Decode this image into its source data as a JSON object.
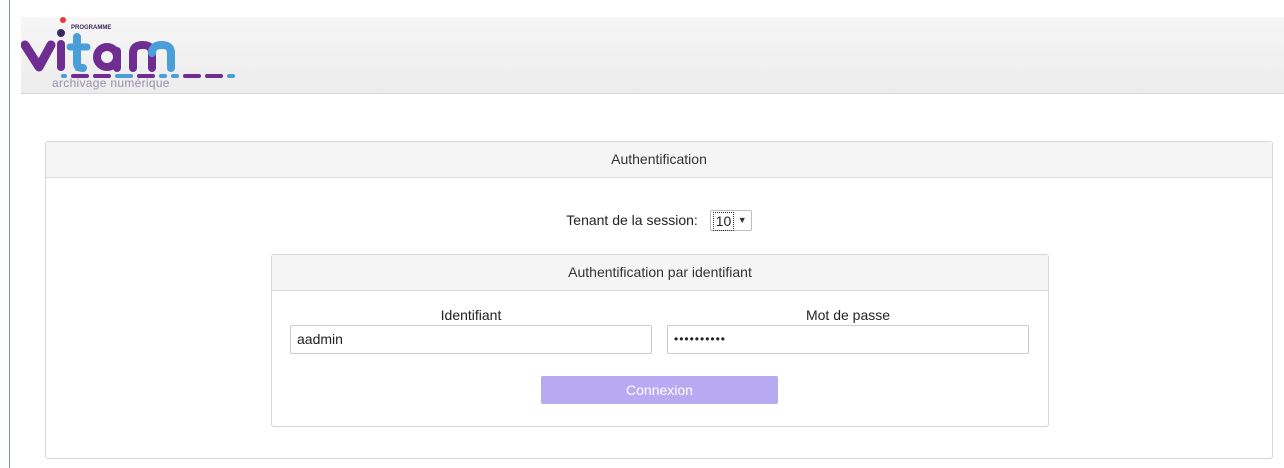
{
  "logo": {
    "programme": "PROGRAMME",
    "name": "vitam",
    "subtitle": "archivage numérique"
  },
  "auth_panel": {
    "title": "Authentification",
    "tenant_label": "Tenant de la session:",
    "tenant_value": "10"
  },
  "id_panel": {
    "title": "Authentification par identifiant",
    "identifiant_label": "Identifiant",
    "identifiant_value": "aadmin",
    "password_label": "Mot de passe",
    "password_value": "••••••••••",
    "connect_label": "Connexion"
  },
  "colors": {
    "button": "#b7a9f2",
    "logo_purple": "#6f2c91",
    "logo_blue": "#4a9fd8"
  }
}
